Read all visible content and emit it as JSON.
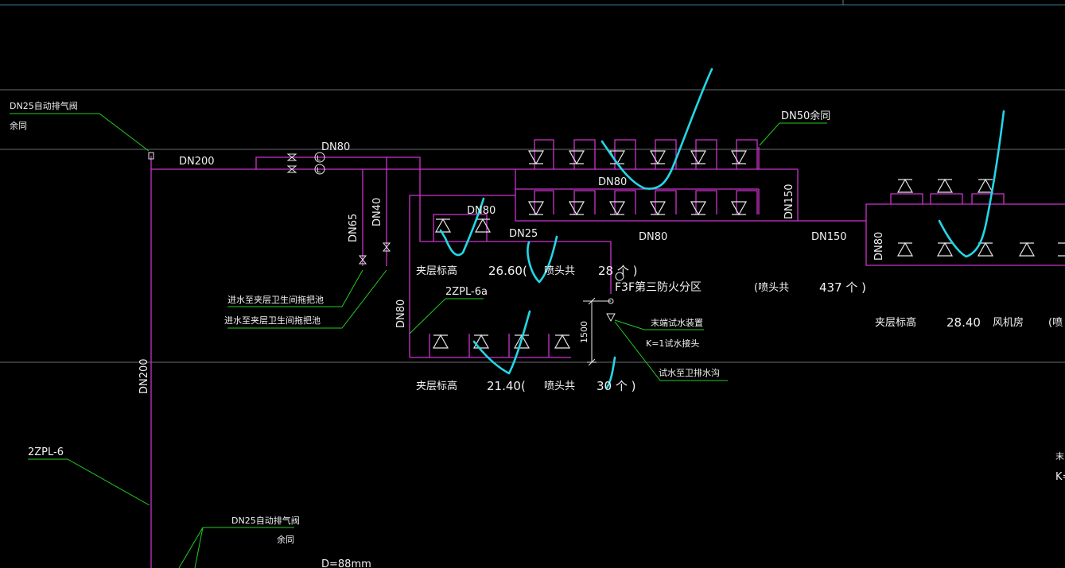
{
  "colors": {
    "background": "#000000",
    "pipe": "#cc33cc",
    "leader": "#22cc22",
    "markup": "#22d8e8",
    "grid": "#8a8f96",
    "text": "#f0f0f0"
  },
  "labels": {
    "air_valve_top": "DN25自动排气阀",
    "same_top": "余同",
    "main_pipe_h": "DN200",
    "main_pipe_v": "DN200",
    "dn80_top": "DN80",
    "dn65": "DN65",
    "dn40": "DN40",
    "water_to_1": "进水至夹层卫生间拖把池",
    "water_to_2": "进水至夹层卫生间拖把池",
    "dn50_same": "DN50余同",
    "dn80_mid": "DN80",
    "dn80_small": "DN80",
    "dn25": "DN25",
    "dn80_branch": "DN80",
    "dn150_v": "DN150",
    "dn150_h": "DN150",
    "dn80_right": "DN80",
    "dn80_riser": "DN80",
    "mezz_1_label": "夹层标高",
    "mezz_1_value": "26.60(",
    "mezz_1_sprk": "喷头共",
    "mezz_1_count": "28 个 )",
    "riser_id_1": "2ZPL-6a",
    "zone_label": "F3F第三防火分区",
    "zone_sprk": "(喷头共",
    "zone_count": "437 个 )",
    "dim_1500": "1500",
    "test_device": "末端试水装置",
    "k_value": "K=1试水接头",
    "drain_to": "试水至卫排水沟",
    "mezz_2_label": "夹层标高",
    "mezz_2_value": "21.40(",
    "mezz_2_sprk": "喷头共",
    "mezz_2_count": "30 个 )",
    "mezz_3_label": "夹层标高",
    "mezz_3_value": "28.40",
    "mezz_3_room": "风机房",
    "mezz_3_paren": "(喷",
    "riser_id_2": "2ZPL-6",
    "air_valve_bottom": "DN25自动排气阀",
    "same_bottom": "余同",
    "diameter": "D=88mm",
    "edge_1": "末",
    "edge_2": "K="
  }
}
